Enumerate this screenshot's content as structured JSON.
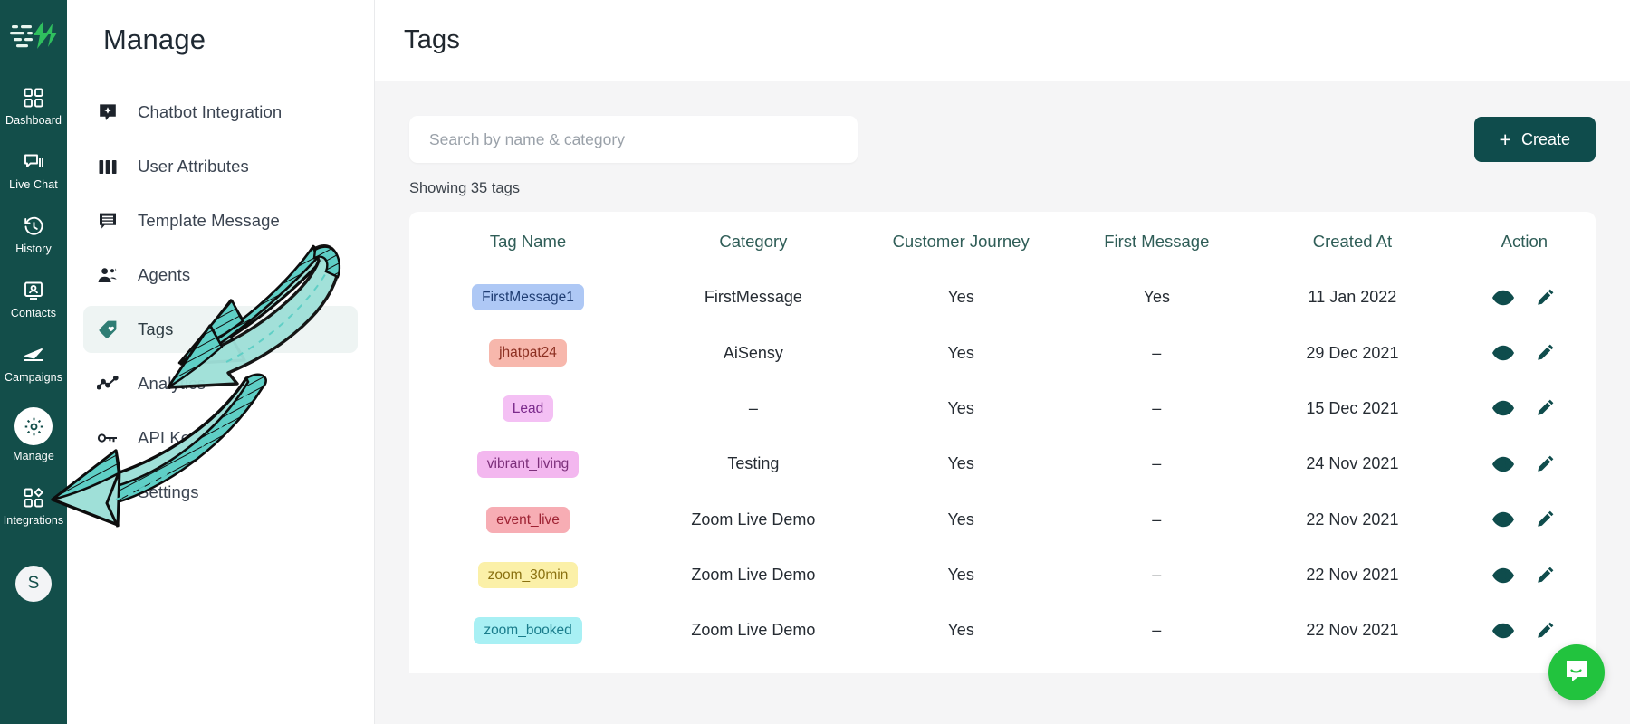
{
  "rail": {
    "logo_icon": "aisensy-logo-icon",
    "items": [
      {
        "label": "Dashboard",
        "icon": "dashboard-icon"
      },
      {
        "label": "Live Chat",
        "icon": "chat-bubbles-icon"
      },
      {
        "label": "History",
        "icon": "clock-history-icon"
      },
      {
        "label": "Contacts",
        "icon": "contacts-card-icon"
      },
      {
        "label": "Campaigns",
        "icon": "paper-plane-icon"
      },
      {
        "label": "Manage",
        "icon": "gear-icon"
      },
      {
        "label": "Integrations",
        "icon": "integrations-icon"
      }
    ],
    "avatar_initial": "S"
  },
  "sidebar": {
    "title": "Manage",
    "items": [
      {
        "label": "Chatbot Integration",
        "icon": "chatbot-icon"
      },
      {
        "label": "User Attributes",
        "icon": "columns-icon"
      },
      {
        "label": "Template Message",
        "icon": "message-template-icon"
      },
      {
        "label": "Agents",
        "icon": "agents-icon"
      },
      {
        "label": "Tags",
        "icon": "tag-icon"
      },
      {
        "label": "Analytics",
        "icon": "analytics-icon"
      },
      {
        "label": "API Key",
        "icon": "key-icon"
      },
      {
        "label": "Settings",
        "icon": "settings-icon"
      }
    ],
    "active_label": "Tags"
  },
  "header": {
    "title": "Tags"
  },
  "toolbar": {
    "search_placeholder": "Search by name & category",
    "search_value": "",
    "create_label": "Create",
    "create_plus": "+"
  },
  "table": {
    "showing_text": "Showing 35 tags",
    "columns": [
      "Tag Name",
      "Category",
      "Customer Journey",
      "First Message",
      "Created At",
      "Action"
    ],
    "rows": [
      {
        "tag": "FirstMessage1",
        "chip_bg": "#aec8f5",
        "chip_fg": "#1f3d73",
        "category": "FirstMessage",
        "journey": "Yes",
        "first_message": "Yes",
        "created_at": "11 Jan 2022"
      },
      {
        "tag": "jhatpat24",
        "chip_bg": "#f7b7ac",
        "chip_fg": "#8c2f21",
        "category": "AiSensy",
        "journey": "Yes",
        "first_message": "–",
        "created_at": "29 Dec 2021"
      },
      {
        "tag": "Lead",
        "chip_bg": "#f4c0f4",
        "chip_fg": "#7b2a8c",
        "category": "–",
        "journey": "Yes",
        "first_message": "–",
        "created_at": "15 Dec 2021"
      },
      {
        "tag": "vibrant_living",
        "chip_bg": "#f3b7ef",
        "chip_fg": "#7c2f7a",
        "category": "Testing",
        "journey": "Yes",
        "first_message": "–",
        "created_at": "24 Nov 2021"
      },
      {
        "tag": "event_live",
        "chip_bg": "#f7adb4",
        "chip_fg": "#9e2233",
        "category": "Zoom Live Demo",
        "journey": "Yes",
        "first_message": "–",
        "created_at": "22 Nov 2021"
      },
      {
        "tag": "zoom_30min",
        "chip_bg": "#fbf0a8",
        "chip_fg": "#8a7110",
        "category": "Zoom Live Demo",
        "journey": "Yes",
        "first_message": "–",
        "created_at": "22 Nov 2021"
      },
      {
        "tag": "zoom_booked",
        "chip_bg": "#a8f0f4",
        "chip_fg": "#1a7d8c",
        "category": "Zoom Live Demo",
        "journey": "Yes",
        "first_message": "–",
        "created_at": "22 Nov 2021"
      }
    ],
    "action_icons": [
      "eye-icon",
      "pencil-icon"
    ]
  },
  "annotations": {
    "arrow_color": "#96dcd5",
    "arrow_outline": "#111111",
    "arrows": [
      {
        "name": "arrow-pointing-to-tags"
      },
      {
        "name": "arrow-pointing-to-manage"
      }
    ]
  },
  "chat_widget": {
    "icon": "intercom-chat-icon",
    "color": "#22c33e"
  },
  "colors": {
    "rail_bg": "#134e4a",
    "accent": "#0f4c4c",
    "page_bg": "#f5f5f6",
    "header_text": "#2f5d57"
  }
}
